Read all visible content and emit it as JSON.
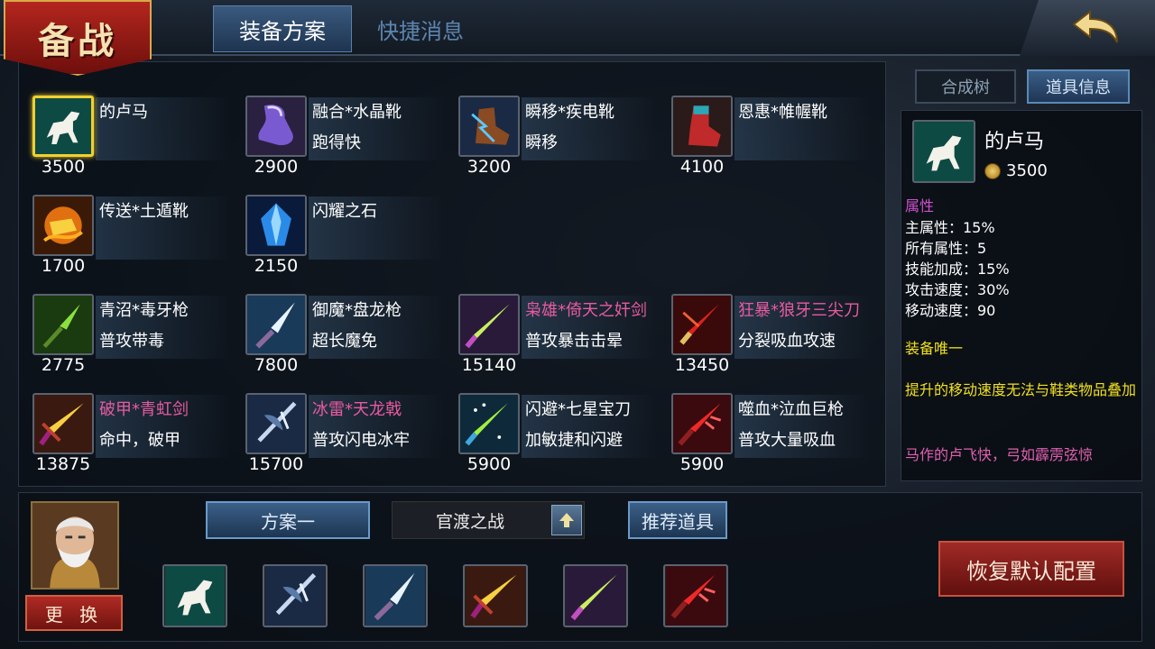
{
  "header": {
    "logo_text": "备战",
    "tabs": [
      {
        "label": "装备方案",
        "active": true
      },
      {
        "label": "快捷消息",
        "active": false
      }
    ]
  },
  "items": [
    {
      "name": "的卢马",
      "desc": "",
      "price": "3500",
      "icon": "white-horse-icon",
      "selected": true,
      "pink": false
    },
    {
      "name": "融合*水晶靴",
      "desc": "跑得快",
      "price": "2900",
      "icon": "crystal-boot-icon",
      "selected": false,
      "pink": false
    },
    {
      "name": "瞬移*疾电靴",
      "desc": "瞬移",
      "price": "3200",
      "icon": "lightning-boot-icon",
      "selected": false,
      "pink": false
    },
    {
      "name": "恩惠*帷幄靴",
      "desc": "",
      "price": "4100",
      "icon": "red-boot-icon",
      "selected": false,
      "pink": false
    },
    {
      "name": "传送*土遁靴",
      "desc": "",
      "price": "1700",
      "icon": "fire-boot-icon",
      "selected": false,
      "pink": false
    },
    {
      "name": "闪耀之石",
      "desc": "",
      "price": "2150",
      "icon": "blue-gem-icon",
      "selected": false,
      "pink": false
    },
    {
      "name": "青沼*毒牙枪",
      "desc": "普攻带毒",
      "price": "2775",
      "icon": "green-spear-icon",
      "selected": false,
      "pink": false
    },
    {
      "name": "御魔*盘龙枪",
      "desc": "超长魔免",
      "price": "7800",
      "icon": "ice-spear-icon",
      "selected": false,
      "pink": false
    },
    {
      "name": "枭雄*倚天之奸剑",
      "desc": "普攻暴击击晕",
      "price": "15140",
      "icon": "jade-sword-icon",
      "selected": false,
      "pink": true
    },
    {
      "name": "狂暴*狼牙三尖刀",
      "desc": "分裂吸血攻速",
      "price": "13450",
      "icon": "trident-blade-icon",
      "selected": false,
      "pink": true
    },
    {
      "name": "破甲*青虹剑",
      "desc": "命中，破甲",
      "price": "13875",
      "icon": "golden-sword-icon",
      "selected": false,
      "pink": true
    },
    {
      "name": "冰雷*天龙戟",
      "desc": "普攻闪电冰牢",
      "price": "15700",
      "icon": "halberd-icon",
      "selected": false,
      "pink": true
    },
    {
      "name": "闪避*七星宝刀",
      "desc": "加敏捷和闪避",
      "price": "5900",
      "icon": "star-blade-icon",
      "selected": false,
      "pink": false
    },
    {
      "name": "噬血*泣血巨枪",
      "desc": "普攻大量吸血",
      "price": "5900",
      "icon": "blood-spear-icon",
      "selected": false,
      "pink": false
    }
  ],
  "right_tabs": [
    {
      "label": "合成树",
      "active": false
    },
    {
      "label": "道具信息",
      "active": true
    }
  ],
  "info": {
    "name": "的卢马",
    "price": "3500",
    "section_title": "属性",
    "stats": [
      "主属性：15%",
      "所有属性：5",
      "技能加成：15%",
      "攻击速度：30%",
      "移动速度：90"
    ],
    "unique": "装备唯一",
    "note": "提升的移动速度无法与鞋类物品叠加",
    "flavor": "马作的卢飞快，弓如霹雳弦惊"
  },
  "bottom": {
    "swap_label": "更 换",
    "plan_label": "方案一",
    "map_label": "官渡之战",
    "recommend_label": "推荐道具",
    "reset_label": "恢复默认配置",
    "slots": [
      "white-horse-icon",
      "halberd-icon",
      "ice-spear-icon",
      "golden-sword-icon",
      "jade-sword-icon",
      "blood-spear-icon"
    ]
  },
  "colors": {
    "pink_name": "#e85aa0",
    "selected_border": "#f0d030",
    "magenta_title": "#d050d0",
    "yellow_text": "#f0e020"
  }
}
